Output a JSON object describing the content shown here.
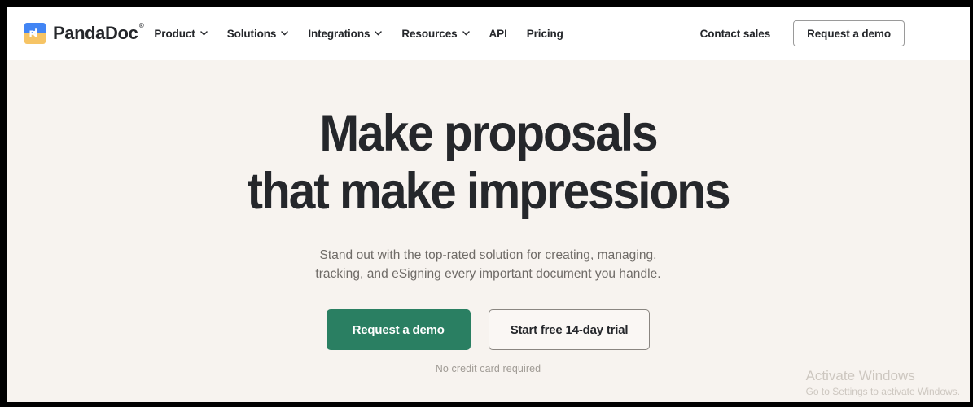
{
  "theme": {
    "header_bg": "#ffffff",
    "page_bg": "#f7f3ef",
    "text_dark": "#25272b",
    "text_muted": "#6f6b67",
    "accent_green": "#2a7f62",
    "logo_blue": "#4285f4",
    "logo_yellow": "#f6c465",
    "frame_black": "#000000"
  },
  "header": {
    "brand": {
      "name": "PandaDoc",
      "logo_glyph": "pd",
      "registered_mark": "®"
    },
    "nav": [
      {
        "label": "Product",
        "has_dropdown": true
      },
      {
        "label": "Solutions",
        "has_dropdown": true
      },
      {
        "label": "Integrations",
        "has_dropdown": true
      },
      {
        "label": "Resources",
        "has_dropdown": true
      },
      {
        "label": "API",
        "has_dropdown": false
      },
      {
        "label": "Pricing",
        "has_dropdown": false
      }
    ],
    "contact_sales_label": "Contact sales",
    "demo_button_label": "Request a demo"
  },
  "hero": {
    "headline_line1": "Make proposals",
    "headline_line2": "that make impressions",
    "subtitle_line1": "Stand out with the top-rated solution for creating, managing,",
    "subtitle_line2": "tracking, and eSigning every important document you handle.",
    "primary_cta_label": "Request a demo",
    "secondary_cta_label": "Start free 14-day trial",
    "note": "No credit card required"
  },
  "watermark": {
    "title": "Activate Windows",
    "subtitle": "Go to Settings to activate Windows."
  }
}
